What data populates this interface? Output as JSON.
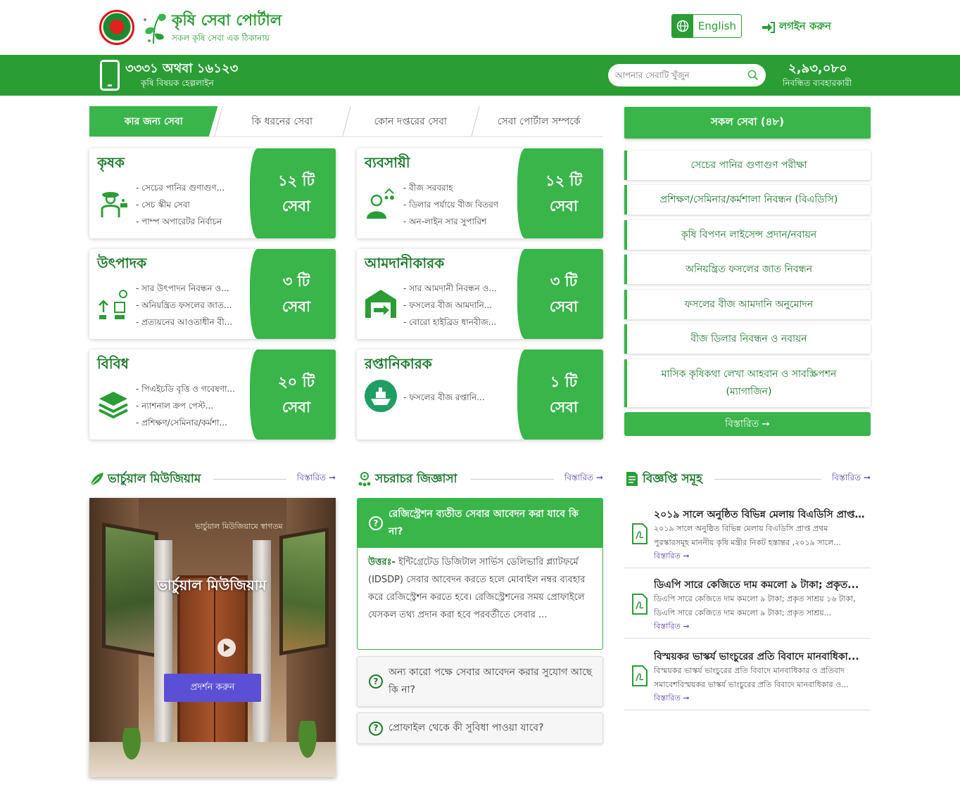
{
  "header": {
    "title": "কৃষি সেবা পোর্টাল",
    "subtitle": "সকল কৃষি সেবা এক ঠিকানায়",
    "language_label": "English",
    "login_label": "লগইন করুন"
  },
  "bar": {
    "helpline_number": "৩৩৩১ অথবা ১৬১২৩",
    "helpline_label": "কৃষি বিষয়ক হেল্পলাইন",
    "search_placeholder": "আপনার সেবাটি খুঁজুন",
    "users_count": "২,৯৩,০৮০",
    "users_label": "নিবন্ধিত ব্যবহারকারী"
  },
  "tabs": [
    "কার জন্য সেবা",
    "কি ধরনের সেবা",
    "কোন দপ্তরের সেবা",
    "সেবা পোর্টাল সম্পর্কে"
  ],
  "categories": [
    {
      "title": "কৃষক",
      "count": "১২ টি",
      "unit": "সেবা",
      "items": [
        "সেচের পানির গুণাগুণ...",
        "সেচ স্কীম সেবা",
        "পাম্প অপারেটর নির্বাচন"
      ]
    },
    {
      "title": "ব্যবসায়ী",
      "count": "১২ টি",
      "unit": "সেবা",
      "items": [
        "বীজ সরবরাহ",
        "ডিলার পর্যায়ে বীজ বিতরণ",
        "অন-লাইন সার সুপারিশ"
      ]
    },
    {
      "title": "উৎপাদক",
      "count": "৩ টি",
      "unit": "সেবা",
      "items": [
        "সার উৎপাদন নিবন্ধন ও...",
        "অনিয়ন্ত্রিত ফসলের জাত...",
        "প্রত্যয়নের আওতাধীন বী..."
      ]
    },
    {
      "title": "আমদানীকারক",
      "count": "৩ টি",
      "unit": "সেবা",
      "items": [
        "সার আমদানী নিবন্ধন ও...",
        "ফসলের বীজ আমদানি...",
        "বোরো হাইব্রিড ধানবীজ..."
      ]
    },
    {
      "title": "বিবিধ",
      "count": "২০ টি",
      "unit": "সেবা",
      "items": [
        "পিএইচডি বৃত্তি ও গবেষণা...",
        "ন্যাশনাল ক্রপ পেস্ট...",
        "প্রশিক্ষণ/সেমিনার/কর্মশা..."
      ]
    },
    {
      "title": "রপ্তানিকারক",
      "count": "১ টি",
      "unit": "সেবা",
      "items": [
        "ফসলের বীজ রপ্তানি..."
      ]
    }
  ],
  "services": {
    "header": "সকল সেবা (৪৮)",
    "items": [
      "সেচের পানির গুণাগুণ পরীক্ষা",
      "প্রশিক্ষণ/সেমিনার/কর্মশালা নিবন্ধন (বিএডিসি)",
      "কৃষি বিপণন লাইসেন্স প্রদান/নবায়ন",
      "অনিয়ন্ত্রিত ফসলের জাত নিবন্ধন",
      "ফসলের বীজ আমদানি অনুমোদন",
      "বীজ ডিলার নিবন্ধন ও নবায়ন",
      "মাসিক কৃষিকথা লেখা আহবান ও সাবস্ক্রিপশন (ম্যাগাজিন)"
    ],
    "more_label": "বিস্তারিত"
  },
  "museum": {
    "section_title": "ভার্চুয়াল মিউজিয়াম",
    "more_label": "বিস্তারিত",
    "arch_text": "ভার্চুয়াল মিউজিয়ামে স্বাগতম",
    "title": "ভার্চুয়াল মিউজিয়াম",
    "button_label": "প্রদর্শন করুন"
  },
  "faq": {
    "section_title": "সচরাচর জিজ্ঞাসা",
    "more_label": "বিস্তারিত",
    "open_question": "রেজিস্ট্রেশন ব্যতীত সেবার আবেদন করা যাবে কি না?",
    "answer_label": "উত্তরঃ-",
    "answer_text": "ইন্টিগ্রেটেড ডিজিটাল সার্ভিস ডেলিভারি প্ল্যাটফর্মে (IDSDP) সেবার আবেদন করতে হলে মোবাইল নম্বর ব্যবহার করে রেজিস্ট্রেশন করতে হবে। রেজিস্ট্রেশনের সময় প্রোফাইলে যেসকল তথ্য প্রদান করা হবে পরবর্তীতে সেবার ...",
    "questions": [
      "অন্য কারো পক্ষে সেবার আবেদন করার সুযোগ আছে কি না?",
      "প্রোফাইল থেকে কী সুবিধা পাওয়া যাবে?"
    ]
  },
  "notices": {
    "section_title": "বিজ্ঞপ্তি সমূহ",
    "more_label": "বিস্তারিত",
    "item_more_label": "বিস্তারিত",
    "items": [
      {
        "title": "২০১৯ সালে অনুষ্ঠিত বিভিন্ন মেলায় বিএডিসি প্রাপ্ত...",
        "desc": "২০১৯ সালে অনুষ্ঠিত বিভিন্ন মেলায় বিএডিসি প্রাপ্ত প্রথম পুরস্কারসমূহ মাননীয় কৃষি মন্ত্রীর নিকট হস্তান্তর ,২০১৯ সালে..."
      },
      {
        "title": "ডিএপি সারে কেজিতে দাম কমলো ৯ টাকা; প্রকৃত...",
        "desc": "ডিএপি সারে কেজিতে দাম কমলো ৯ টাকা; প্রকৃত সাশ্রয় ১৬ টাকা, ডিএপি সারে কেজিতে দাম কমলো ৯ টাকা; প্রকৃত সাশ্রয়..."
      },
      {
        "title": "বিস্ময়কর ভাস্কর্য ভাংচুরের প্রতি বিবাদে মানবাধিকা...",
        "desc": "বিস্ময়কর ভাস্কর্য ভাংচুরের প্রতি বিবাদে মানবাধিকার ও প্রতিবাদ সমাবেশবিস্ময়কর ভাস্কর্য ভাংচুরের প্রতি বিবাদে মানবাধিকার ও..."
      }
    ]
  },
  "colors": {
    "brand_green": "#39b54a",
    "dark_green": "#1d7a2b",
    "bar_green": "#2a9d35",
    "accent_purple": "#5b4fd6"
  }
}
